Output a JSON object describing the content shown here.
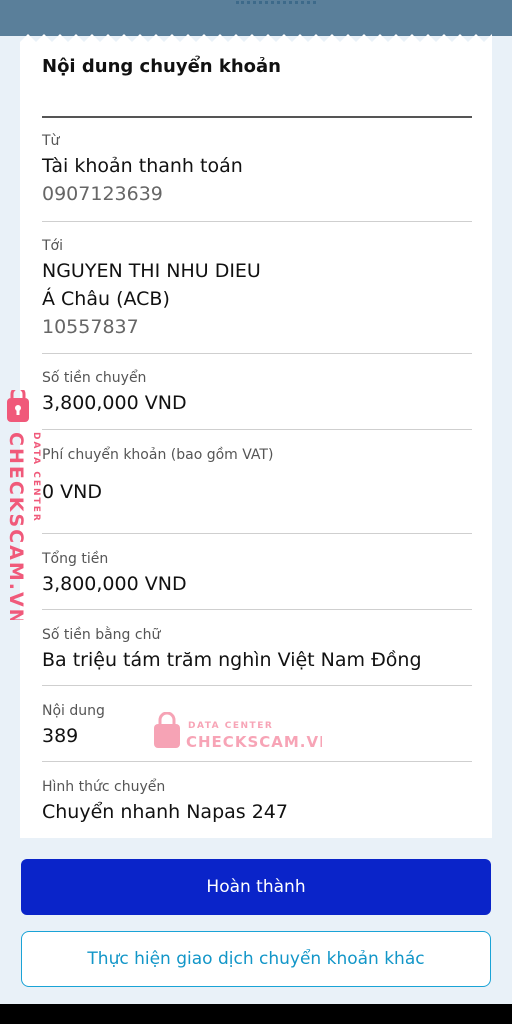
{
  "receipt": {
    "title": "Nội dung chuyển khoản",
    "from": {
      "label": "Từ",
      "account_name": "Tài khoản thanh toán",
      "account_number": "0907123639"
    },
    "to": {
      "label": "Tới",
      "name": "NGUYEN THI NHU DIEU",
      "bank": "Á Châu (ACB)",
      "account_number": "10557837"
    },
    "amount": {
      "label": "Số tiền chuyển",
      "value": "3,800,000 VND"
    },
    "fee": {
      "label": "Phí chuyển khoản (bao gồm VAT)",
      "value": "0 VND"
    },
    "total": {
      "label": "Tổng tiền",
      "value": "3,800,000 VND"
    },
    "amount_words": {
      "label": "Số tiền bằng chữ",
      "value": "Ba triệu tám trăm nghìn Việt Nam Đồng"
    },
    "content": {
      "label": "Nội dung",
      "value": "389"
    },
    "method": {
      "label": "Hình thức chuyển",
      "value": "Chuyển nhanh Napas 247"
    }
  },
  "actions": {
    "done_label": "Hoàn thành",
    "another_transfer_label": "Thực hiện giao dịch chuyển khoản khác"
  },
  "watermark": {
    "brand": "CHECKSCAM.VN",
    "tagline": "DATA CENTER",
    "icon": "lock-icon",
    "color": "#f0597a"
  },
  "colors": {
    "primary_button": "#0a24c9",
    "secondary_border": "#1aa3d6",
    "header": "#5a7f9a"
  }
}
